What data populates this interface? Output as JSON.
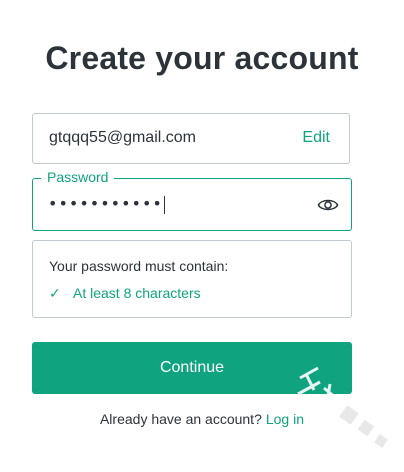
{
  "title": "Create your account",
  "email_field": {
    "value": "gtqqq55@gmail.com",
    "edit_label": "Edit"
  },
  "password_field": {
    "label": "Password",
    "value": "•••••••••••",
    "toggle_icon": "eye-icon"
  },
  "requirements": {
    "title": "Your password must contain:",
    "items": [
      {
        "check": "✓",
        "text": "At least 8 characters"
      }
    ]
  },
  "continue_button": {
    "label": "Continue"
  },
  "footer": {
    "text": "Already have an account?",
    "login_label": "Log in"
  },
  "colors": {
    "accent": "#10a37f",
    "text": "#2d333a",
    "border": "#c2c8d0"
  }
}
